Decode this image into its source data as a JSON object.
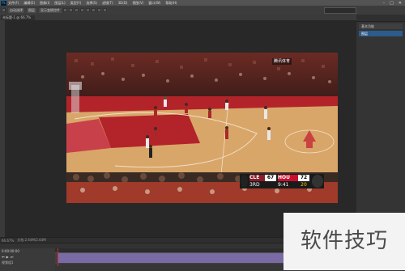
{
  "menu": {
    "app_icon_label": "Ps",
    "items": [
      "文件(F)",
      "编辑(E)",
      "图像(I)",
      "图层(L)",
      "类型(Y)",
      "选择(S)",
      "滤镜(T)",
      "3D(D)",
      "视图(V)",
      "窗口(W)",
      "帮助(H)"
    ],
    "window_controls": [
      "–",
      "□",
      "✕"
    ]
  },
  "options_bar": {
    "label_1": "自动选择",
    "label_2": "图层",
    "label_3": "显示变换控件"
  },
  "document": {
    "tab_label": "未标题-1 @ 66.7%"
  },
  "right_panel": {
    "items": [
      {
        "label": "基本功能",
        "active": false
      },
      {
        "label": "图层",
        "active": true
      }
    ]
  },
  "scoreboard": {
    "team1": "CLE",
    "score1": "67",
    "team2": "HOU",
    "score2": "72",
    "quarter": "3RD",
    "clock": "9:41",
    "shot_clock": "20",
    "broadcaster": "腾讯体育"
  },
  "status": {
    "zoom": "66.67%",
    "doc_info": "文档:2.64M/2.64M"
  },
  "timeline": {
    "time": "0:00:00:00",
    "label": "视频组1"
  },
  "watermark": {
    "text": "软件技巧"
  },
  "colors": {
    "accent": "#2d5b8c",
    "clip": "#7a6ba6",
    "playhead": "#d62828"
  }
}
